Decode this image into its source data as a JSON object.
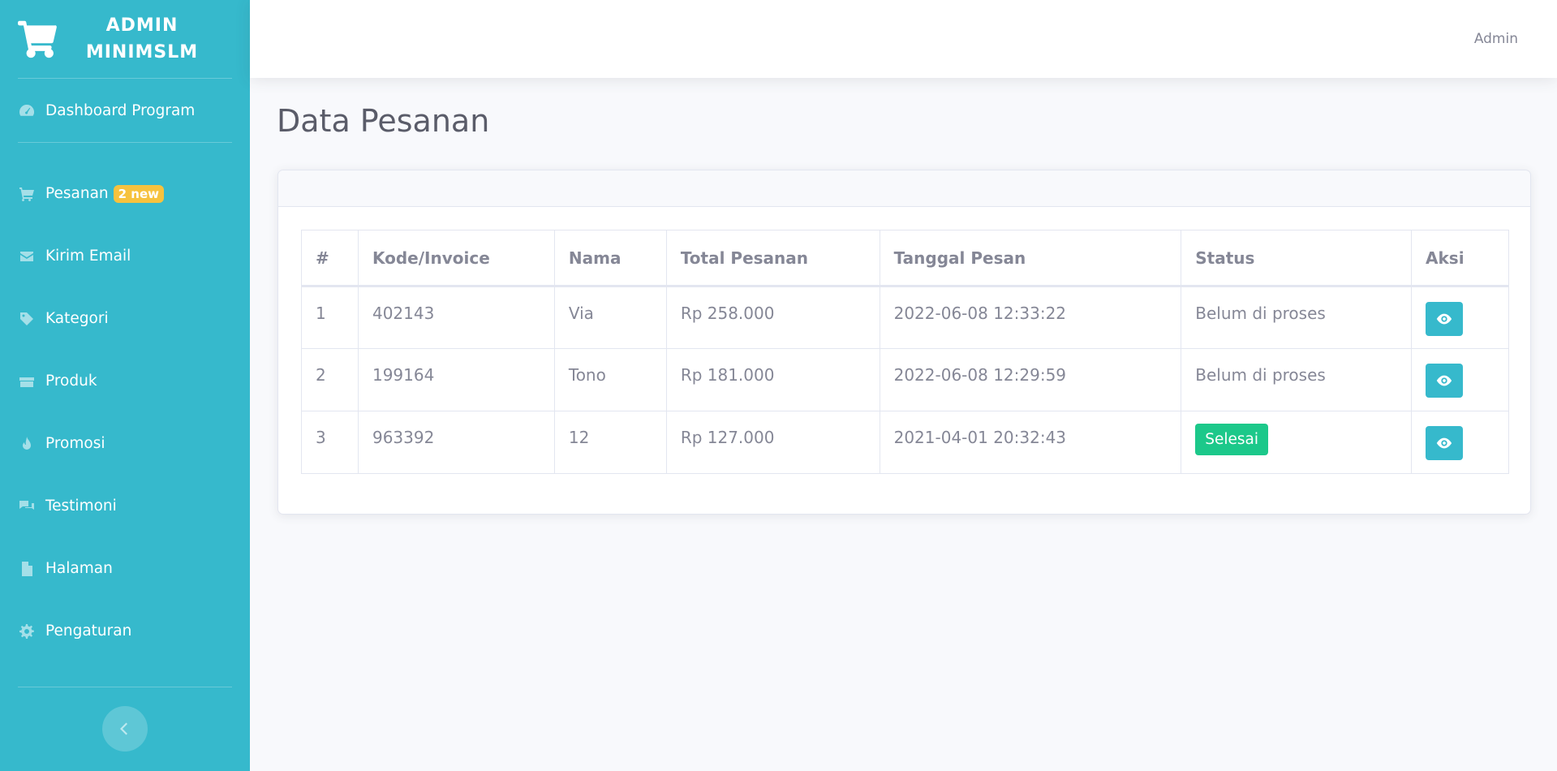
{
  "brand": {
    "line1": "ADMIN",
    "line2": "MINIMSLM",
    "icon": "shopping-cart-icon"
  },
  "sidebar": {
    "items": [
      {
        "label": "Dashboard Program",
        "icon": "tachometer-icon"
      },
      {
        "label": "Pesanan",
        "icon": "cart-icon",
        "badge": "2 new"
      },
      {
        "label": "Kirim Email",
        "icon": "envelope-icon"
      },
      {
        "label": "Kategori",
        "icon": "tag-icon"
      },
      {
        "label": "Produk",
        "icon": "box-icon"
      },
      {
        "label": "Promosi",
        "icon": "fire-icon"
      },
      {
        "label": "Testimoni",
        "icon": "comments-icon"
      },
      {
        "label": "Halaman",
        "icon": "file-icon"
      },
      {
        "label": "Pengaturan",
        "icon": "cog-icon"
      }
    ],
    "toggle_icon": "chevron-left-icon"
  },
  "topbar": {
    "user": "Admin"
  },
  "page": {
    "title": "Data Pesanan"
  },
  "table": {
    "headers": [
      "#",
      "Kode/Invoice",
      "Nama",
      "Total Pesanan",
      "Tanggal Pesan",
      "Status",
      "Aksi"
    ],
    "rows": [
      {
        "no": "1",
        "invoice": "402143",
        "nama": "Via",
        "total": "Rp 258.000",
        "tanggal": "2022-06-08 12:33:22",
        "status": "Belum di proses",
        "status_done": false
      },
      {
        "no": "2",
        "invoice": "199164",
        "nama": "Tono",
        "total": "Rp 181.000",
        "tanggal": "2022-06-08 12:29:59",
        "status": "Belum di proses",
        "status_done": false
      },
      {
        "no": "3",
        "invoice": "963392",
        "nama": "12",
        "total": "Rp 127.000",
        "tanggal": "2021-04-01 20:32:43",
        "status": "Selesai",
        "status_done": true
      }
    ],
    "action_icon": "eye-icon"
  },
  "colors": {
    "primary": "#36b9cc",
    "success": "#1cc88a",
    "warning": "#f6c23e"
  }
}
